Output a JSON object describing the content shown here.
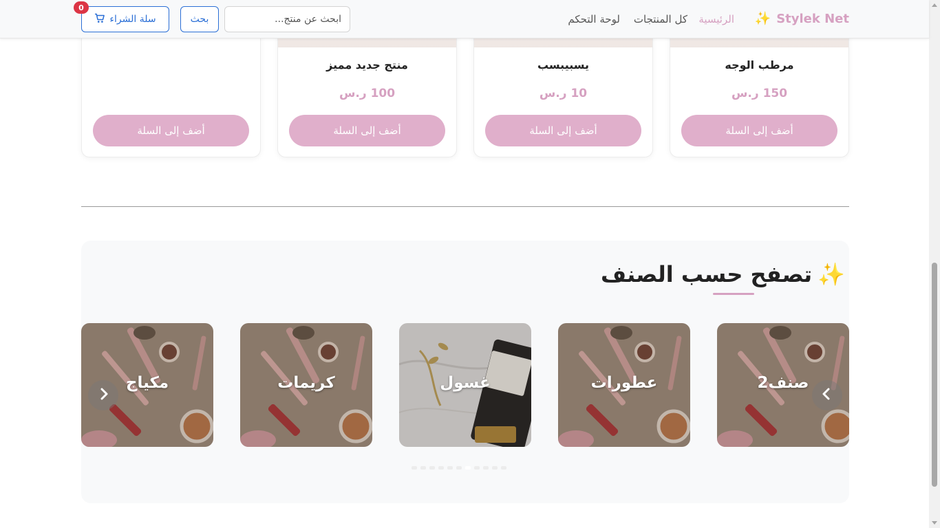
{
  "navbar": {
    "brand": "Stylek Net",
    "brand_icon": "sparkles-icon",
    "links": [
      {
        "label": "الرئيسية",
        "active": true
      },
      {
        "label": "كل المنتجات",
        "active": false
      },
      {
        "label": "لوحة التحكم",
        "active": false
      }
    ],
    "search_placeholder": "ابحث عن منتج...",
    "search_button": "بحث",
    "cart_label": "سلة الشراء",
    "cart_icon": "shopping-cart-icon",
    "cart_count": "0"
  },
  "products": [
    {
      "name": "مرطب الوجه",
      "price": "150 ر.س",
      "button": "أضف إلى السلة"
    },
    {
      "name": "يسبيبسب",
      "price": "10 ر.س",
      "button": "أضف إلى السلة"
    },
    {
      "name": "منتج جديد مميز",
      "price": "100 ر.س",
      "button": "أضف إلى السلة"
    },
    {
      "name": "",
      "price": "",
      "button": "أضف إلى السلة"
    }
  ],
  "categories_section": {
    "title": "تصفح حسب الصنف",
    "title_icon": "sparkles-icon",
    "items": [
      {
        "label": "صنف2"
      },
      {
        "label": "عطورات"
      },
      {
        "label": "غسول"
      },
      {
        "label": "كريمات"
      },
      {
        "label": "مكياج"
      }
    ],
    "dots_count": 11,
    "active_dot": 6
  },
  "colors": {
    "accent": "#d6a1c1",
    "button_pink": "#e0afcb",
    "primary_blue": "#2b6fd6",
    "badge_red": "#dc3545"
  }
}
